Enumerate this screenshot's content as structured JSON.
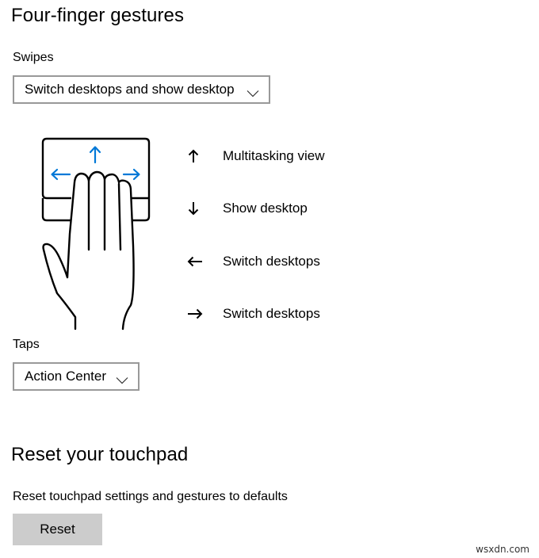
{
  "four_finger_gestures": {
    "title": "Four-finger gestures",
    "swipes": {
      "label": "Swipes",
      "selected": "Switch desktops and show desktop"
    },
    "legend": [
      {
        "icon": "arrow-up-icon",
        "glyph": "up",
        "label": "Multitasking view"
      },
      {
        "icon": "arrow-down-icon",
        "glyph": "down",
        "label": "Show desktop"
      },
      {
        "icon": "arrow-left-icon",
        "glyph": "left",
        "label": "Switch desktops"
      },
      {
        "icon": "arrow-right-icon",
        "glyph": "right",
        "label": "Switch desktops"
      }
    ],
    "taps": {
      "label": "Taps",
      "selected": "Action Center"
    }
  },
  "reset_touchpad": {
    "title": "Reset your touchpad",
    "description": "Reset touchpad settings and gestures to defaults",
    "button_label": "Reset"
  },
  "watermark": "wsxdn.com",
  "colors": {
    "accent": "#0078d7",
    "dropdown_border": "#999999",
    "button_bg": "#cccccc"
  }
}
